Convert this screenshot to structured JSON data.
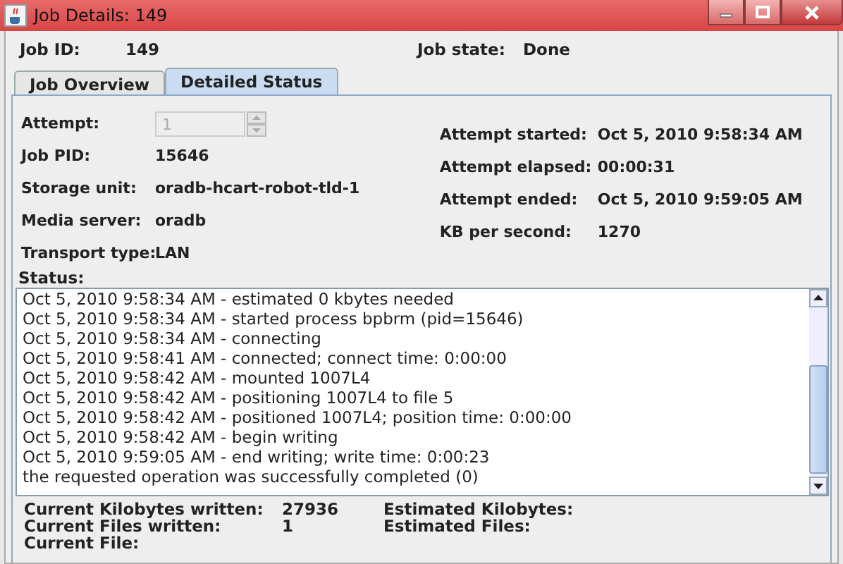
{
  "window": {
    "title": "Job Details: 149"
  },
  "header": [
    {
      "label": "Job ID:",
      "value": "149"
    },
    {
      "label": "Job state:",
      "value": "Done"
    }
  ],
  "tabs": [
    {
      "label": "Job Overview",
      "selected": false
    },
    {
      "label": "Detailed Status",
      "selected": true
    }
  ],
  "attempt": {
    "label": "Attempt:",
    "value": "1",
    "disabled": true
  },
  "left_fields": [
    {
      "label": "Job PID:",
      "value": "15646"
    },
    {
      "label": "Storage unit:",
      "value": "oradb-hcart-robot-tld-1"
    },
    {
      "label": "Media server:",
      "value": "oradb"
    },
    {
      "label": "Transport type:",
      "value": "LAN"
    }
  ],
  "right_fields": [
    {
      "label": "Attempt started:",
      "value": "Oct 5, 2010 9:58:34 AM"
    },
    {
      "label": "Attempt elapsed:",
      "value": "00:00:31"
    },
    {
      "label": "Attempt ended:",
      "value": "Oct 5, 2010 9:59:05 AM"
    },
    {
      "label": "KB per second:",
      "value": "1270"
    }
  ],
  "status": {
    "label": "Status:",
    "lines": [
      "Oct 5, 2010 9:58:34 AM - estimated 0 kbytes needed",
      "Oct 5, 2010 9:58:34 AM - started process bpbrm (pid=15646)",
      "Oct 5, 2010 9:58:34 AM - connecting",
      "Oct 5, 2010 9:58:41 AM - connected; connect time: 0:00:00",
      "Oct 5, 2010 9:58:42 AM - mounted 1007L4",
      "Oct 5, 2010 9:58:42 AM - positioning 1007L4 to file 5",
      "Oct 5, 2010 9:58:42 AM - positioned 1007L4; position time: 0:00:00",
      "Oct 5, 2010 9:58:42 AM - begin writing",
      "Oct 5, 2010 9:59:05 AM - end writing; write time: 0:00:23",
      "the requested operation was successfully completed  (0)"
    ]
  },
  "summary": [
    {
      "label": "Current Kilobytes written:",
      "value": "27936",
      "label_2": "Estimated Kilobytes:"
    },
    {
      "label": "Current Files written:",
      "value": "1",
      "label_2": "Estimated Files:"
    },
    {
      "label": "Current File:"
    }
  ]
}
